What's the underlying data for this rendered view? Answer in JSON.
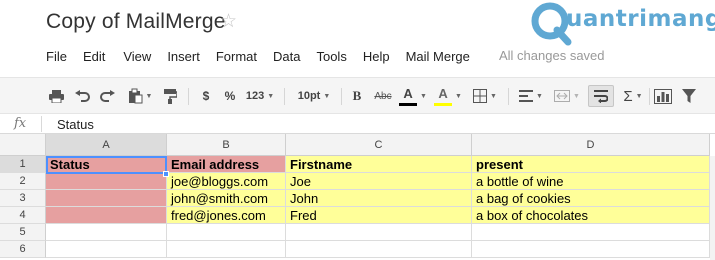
{
  "document": {
    "title": "Copy of MailMerge",
    "star_glyph": "☆"
  },
  "watermark": {
    "text": "uantrimang"
  },
  "menu": {
    "items": [
      "File",
      "Edit",
      "View",
      "Insert",
      "Format",
      "Data",
      "Tools",
      "Help",
      "Mail Merge"
    ],
    "save_status": "All changes saved"
  },
  "toolbar": {
    "currency_label": "$",
    "percent_label": "%",
    "number_format_label": "123",
    "font_size_label": "10pt",
    "bold_label": "B",
    "strikethrough_label": "Abc",
    "text_color_label": "A",
    "fill_color_label": "A",
    "sum_label": "Σ",
    "icons": [
      "print-icon",
      "undo-icon",
      "redo-icon",
      "paste-format-icon",
      "paint-format-icon",
      "borders-icon",
      "align-left-icon",
      "merge-cells-icon",
      "wrap-text-icon",
      "sum-icon",
      "chart-icon",
      "filter-icon"
    ],
    "text_color_value": "#000000",
    "fill_color_value": "#ffff00"
  },
  "formula_bar": {
    "fx_label": "fx",
    "content": "Status"
  },
  "grid": {
    "columns": [
      "A",
      "B",
      "C",
      "D"
    ],
    "selected_cell": "A1",
    "rows": [
      {
        "num": "1",
        "cells": [
          "Status",
          "Email address",
          "Firstname",
          "present"
        ]
      },
      {
        "num": "2",
        "cells": [
          "",
          "joe@bloggs.com",
          "Joe",
          "a bottle of wine"
        ]
      },
      {
        "num": "3",
        "cells": [
          "",
          "john@smith.com",
          "John",
          "a bag of cookies"
        ]
      },
      {
        "num": "4",
        "cells": [
          "",
          "fred@jones.com",
          "Fred",
          "a box of chocolates"
        ]
      },
      {
        "num": "5",
        "cells": [
          "",
          "",
          "",
          ""
        ]
      },
      {
        "num": "6",
        "cells": [
          "",
          "",
          "",
          ""
        ]
      }
    ]
  },
  "colors": {
    "highlight_yellow": "#ffff99",
    "highlight_pink": "#e6a0a0",
    "selection_blue": "#4d90fe"
  }
}
